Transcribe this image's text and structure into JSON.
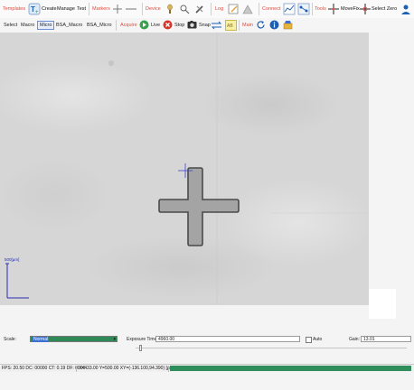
{
  "ribbon": {
    "templates_group": "Templates",
    "create_label": "Create",
    "manage_label": "Manage",
    "test_label": "Test",
    "markers_group": "Markers",
    "device_group": "Device",
    "log_group": "Log",
    "connect_group": "Connect",
    "tools_group": "Tools",
    "movefix_label": "MoveFix",
    "select_zero_label": "Select Zero"
  },
  "toolbar": {
    "select_label": "Select",
    "macro_label": "Macro",
    "micro_label": "Micro",
    "bsa_macro_label": "BSA_Macro",
    "bsa_micro_label": "BSA_Micro",
    "acquire_label": "Acquire",
    "live_label": "Live",
    "stop_label": "Stop",
    "snap_label": "Snap",
    "main_label": "Main"
  },
  "view": {
    "scalebar_label": "500[µm]"
  },
  "controls": {
    "scale_label": "Scale:",
    "scale_value": "Normal",
    "exposure_label": "Exposure Time:",
    "exposure_value": "4960.00",
    "auto_label": "Auto",
    "gain_label": "Gain:",
    "gain_value": "13.01"
  },
  "status": {
    "fps_text": "FPS: 20.50  DC: 00000  CT: 0.19  DF: 0000",
    "coords_text": "X=433.00 Y=500.00 XY=(-136.100,94.390) [µm]"
  },
  "colors": {
    "accent_red": "#e24a3b",
    "progress_green": "#2f8e5c",
    "selection_blue": "#3b6fd0"
  }
}
